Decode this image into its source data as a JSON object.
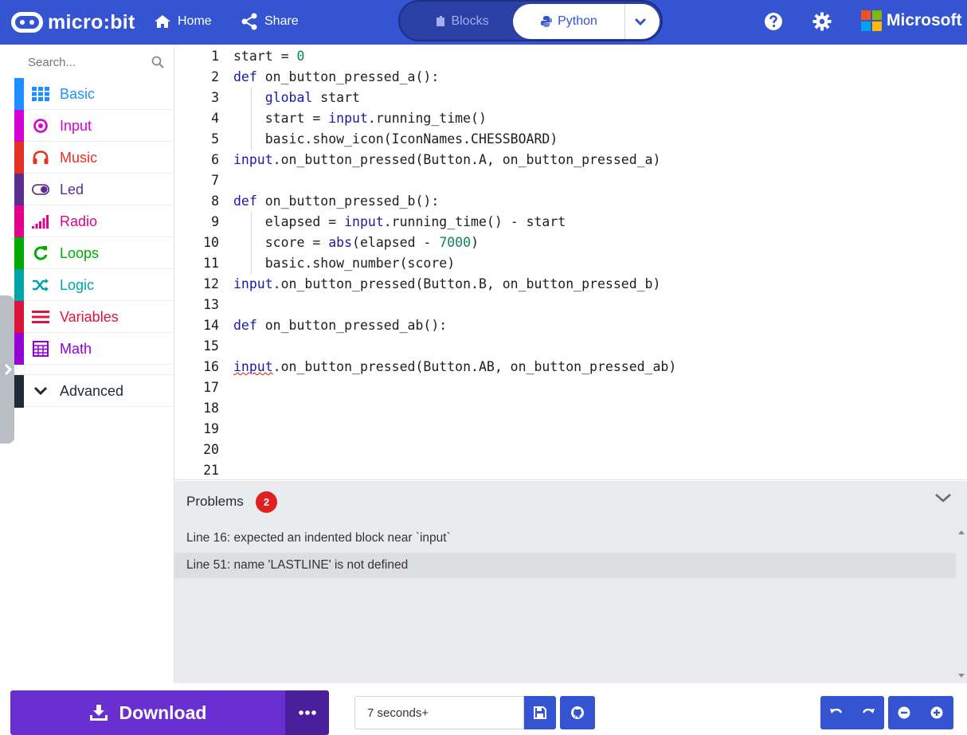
{
  "header": {
    "app_name": "micro:bit",
    "nav_home": "Home",
    "nav_share": "Share",
    "mode_blocks": "Blocks",
    "mode_python": "Python",
    "brand": "Microsoft",
    "icons": [
      "home-icon",
      "share-icon",
      "blocks-icon",
      "python-icon",
      "chevron-down-icon",
      "help-icon",
      "gear-icon"
    ],
    "colors": {
      "bar": "#3454d1"
    }
  },
  "toolbox": {
    "search_placeholder": "Search...",
    "categories": [
      {
        "label": "Basic",
        "color": "#1e90ff",
        "icon": "grid-icon"
      },
      {
        "label": "Input",
        "color": "#d400d4",
        "icon": "target-icon"
      },
      {
        "label": "Music",
        "color": "#e63022",
        "icon": "headphones-icon"
      },
      {
        "label": "Led",
        "color": "#5c2d91",
        "icon": "toggle-icon"
      },
      {
        "label": "Radio",
        "color": "#e3008c",
        "icon": "signal-icon"
      },
      {
        "label": "Loops",
        "color": "#00aa00",
        "icon": "refresh-icon"
      },
      {
        "label": "Logic",
        "color": "#00a4a6",
        "icon": "shuffle-icon"
      },
      {
        "label": "Variables",
        "color": "#dc143c",
        "icon": "list-icon"
      },
      {
        "label": "Math",
        "color": "#9400d3",
        "icon": "calculator-icon"
      }
    ],
    "advanced": {
      "label": "Advanced",
      "color": "#1f2a36"
    }
  },
  "editor": {
    "lines": [
      {
        "n": "1",
        "segs": [
          [
            "t",
            "start = "
          ],
          [
            "num",
            "0"
          ]
        ]
      },
      {
        "n": "2",
        "segs": [
          [
            "kw",
            "def"
          ],
          [
            "t",
            " on_button_pressed_a():"
          ]
        ]
      },
      {
        "n": "3",
        "segs": [
          [
            "t",
            "    "
          ],
          [
            "kw",
            "global"
          ],
          [
            "t",
            " start"
          ]
        ]
      },
      {
        "n": "4",
        "segs": [
          [
            "t",
            "    start = "
          ],
          [
            "kw",
            "input"
          ],
          [
            "t",
            ".running_time()"
          ]
        ]
      },
      {
        "n": "5",
        "segs": [
          [
            "t",
            "    basic.show_icon(IconNames.CHESSBOARD)"
          ]
        ]
      },
      {
        "n": "6",
        "segs": [
          [
            "kw",
            "input"
          ],
          [
            "t",
            ".on_button_pressed(Button.A, on_button_pressed_a)"
          ]
        ]
      },
      {
        "n": "7",
        "segs": []
      },
      {
        "n": "8",
        "segs": [
          [
            "kw",
            "def"
          ],
          [
            "t",
            " on_button_pressed_b():"
          ]
        ]
      },
      {
        "n": "9",
        "segs": [
          [
            "t",
            "    elapsed = "
          ],
          [
            "kw",
            "input"
          ],
          [
            "t",
            ".running_time() - start"
          ]
        ]
      },
      {
        "n": "10",
        "segs": [
          [
            "t",
            "    score = "
          ],
          [
            "kw",
            "abs"
          ],
          [
            "t",
            "(elapsed - "
          ],
          [
            "num",
            "7000"
          ],
          [
            "t",
            ")"
          ]
        ]
      },
      {
        "n": "11",
        "segs": [
          [
            "t",
            "    basic.show_number(score)"
          ]
        ]
      },
      {
        "n": "12",
        "segs": [
          [
            "kw",
            "input"
          ],
          [
            "t",
            ".on_button_pressed(Button.B, on_button_pressed_b)"
          ]
        ]
      },
      {
        "n": "13",
        "segs": []
      },
      {
        "n": "14",
        "segs": [
          [
            "kw",
            "def"
          ],
          [
            "t",
            " on_button_pressed_ab():"
          ]
        ]
      },
      {
        "n": "15",
        "segs": []
      },
      {
        "n": "16",
        "segs": [
          [
            "kwerr",
            "input"
          ],
          [
            "t",
            ".on_button_pressed(Button.AB, on_button_pressed_ab)"
          ]
        ]
      },
      {
        "n": "17",
        "segs": []
      },
      {
        "n": "18",
        "segs": []
      },
      {
        "n": "19",
        "segs": []
      },
      {
        "n": "20",
        "segs": []
      },
      {
        "n": "21",
        "segs": []
      }
    ]
  },
  "problems": {
    "title": "Problems",
    "count": "2",
    "items": [
      "Line 16: expected an indented block near `input`",
      "Line 51: name 'LASTLINE' is not defined"
    ]
  },
  "bottom": {
    "download_label": "Download",
    "project_name": "7 seconds+",
    "colors": {
      "download": "#6a2fd1",
      "download_more": "#4a1f9c",
      "buttons": "#3454d1"
    }
  }
}
